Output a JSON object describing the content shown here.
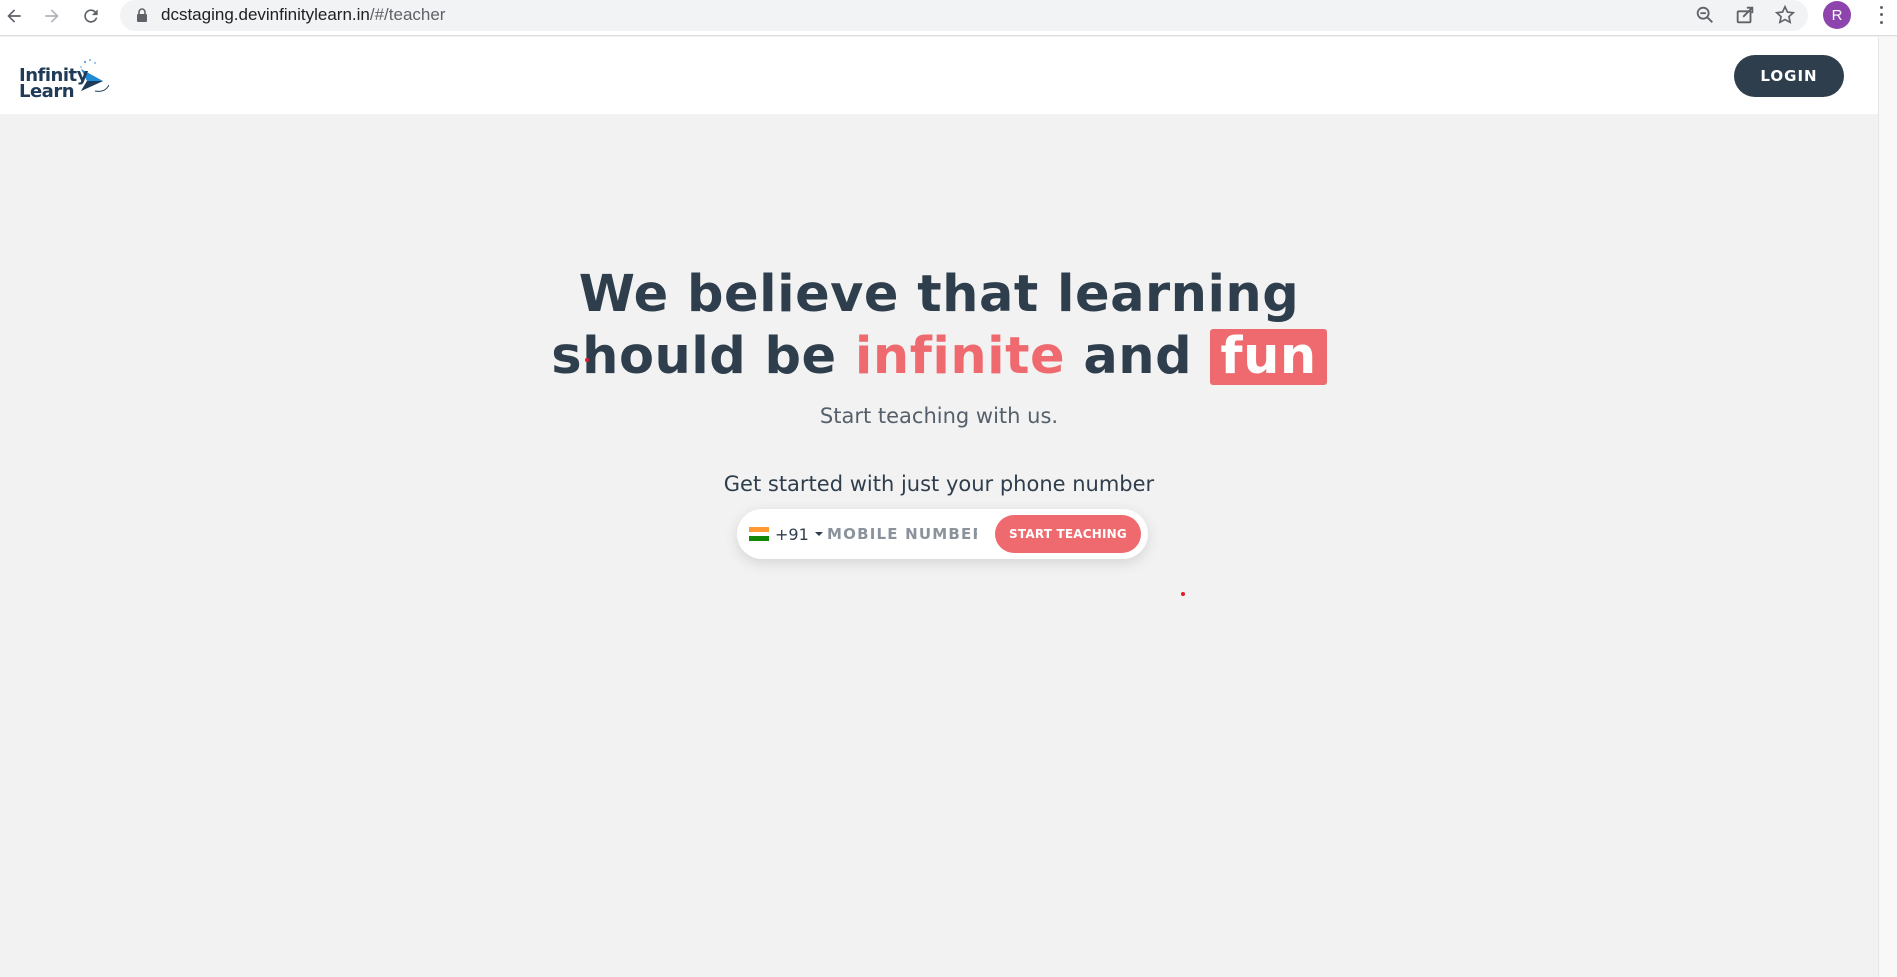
{
  "browser": {
    "url_domain": "dcstaging.devinfinitylearn.in",
    "url_path": "/#/teacher",
    "profile_initial": "R"
  },
  "header": {
    "logo_line1": "Infinity",
    "logo_line2": "Learn",
    "login_label": "LOGIN"
  },
  "hero": {
    "headline_line1": "We believe that learning",
    "headline_line2_start": "should be ",
    "headline_highlight": "infinite",
    "headline_and": " and ",
    "headline_boxed": "fun",
    "subline": "Start teaching with us.",
    "get_started": "Get started with just your phone number"
  },
  "phone_form": {
    "country_code": "+91",
    "mobile_placeholder": "MOBILE NUMBER",
    "start_label": "START TEACHING"
  },
  "colors": {
    "accent": "#ee6a6e",
    "dark": "#2f3e4c",
    "background": "#f2f2f2"
  }
}
